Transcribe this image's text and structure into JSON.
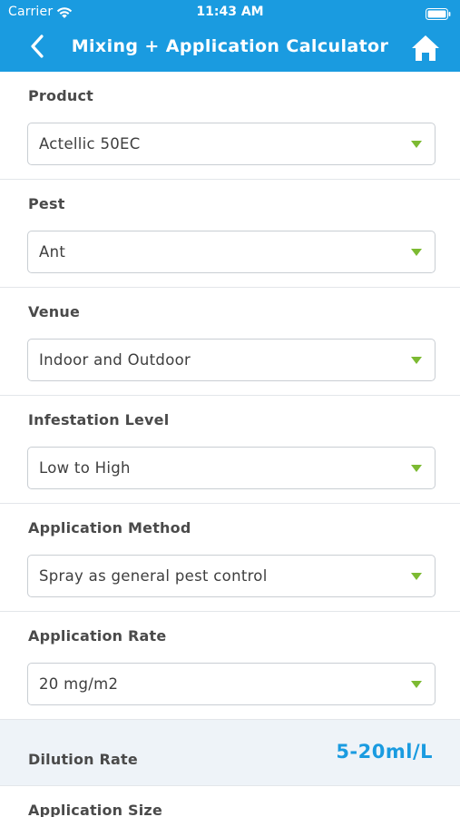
{
  "status_bar": {
    "carrier": "Carrier",
    "time": "11:43 AM"
  },
  "nav": {
    "title": "Mixing + Application Calculator",
    "back_icon": "chevron-left-icon",
    "home_icon": "home-icon",
    "bar_color": "#1a9be0"
  },
  "fields": [
    {
      "label": "Product",
      "value": "Actellic 50EC"
    },
    {
      "label": "Pest",
      "value": "Ant"
    },
    {
      "label": "Venue",
      "value": "Indoor and Outdoor"
    },
    {
      "label": "Infestation Level",
      "value": "Low to High"
    },
    {
      "label": "Application Method",
      "value": "Spray as general pest control"
    },
    {
      "label": "Application Rate",
      "value": "20 mg/m2"
    }
  ],
  "result": {
    "label": "Dilution Rate",
    "value": "5-20ml/L"
  },
  "next_section": {
    "label": "Application Size"
  },
  "colors": {
    "accent": "#1a9be0",
    "dropdown_arrow": "#7cba32",
    "result_background": "#eef3f8"
  }
}
